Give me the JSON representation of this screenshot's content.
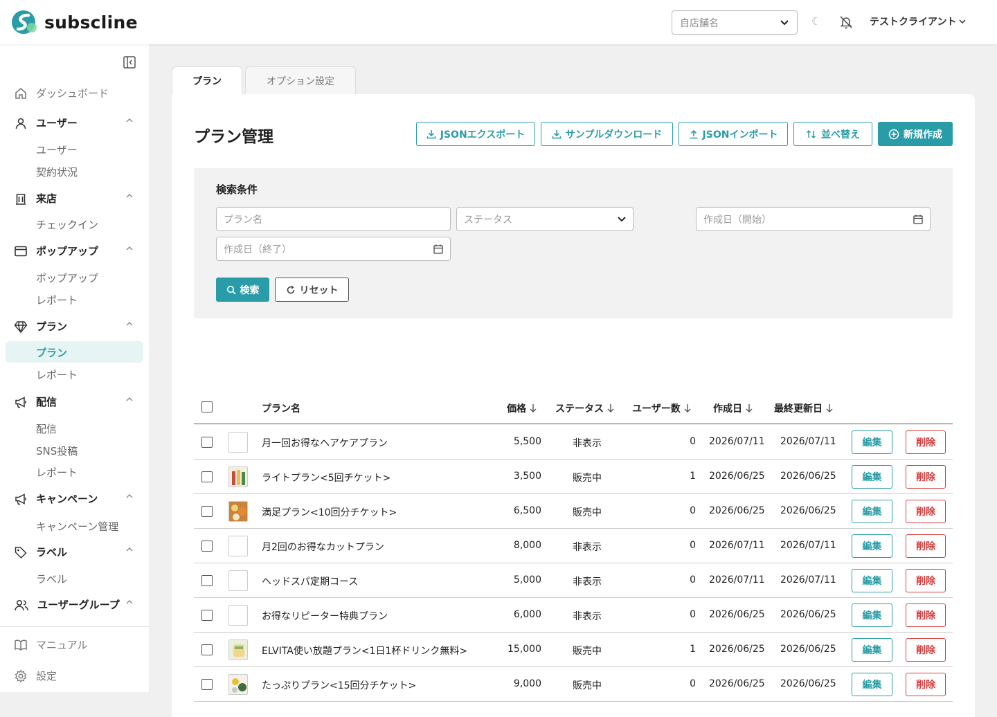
{
  "app": {
    "name": "subscline"
  },
  "header": {
    "store_placeholder": "自店舗名",
    "moon_glyph": "☾",
    "user_name": "テストクライアント"
  },
  "sidebar": {
    "items": [
      {
        "label": "ダッシュボード",
        "icon": "home-icon"
      },
      {
        "label": "ユーザー",
        "icon": "user-icon",
        "subs": [
          "ユーザー",
          "契約状況"
        ]
      },
      {
        "label": "来店",
        "icon": "building-icon",
        "subs": [
          "チェックイン"
        ]
      },
      {
        "label": "ポップアップ",
        "icon": "window-icon",
        "subs": [
          "ポップアップ",
          "レポート"
        ]
      },
      {
        "label": "プラン",
        "icon": "gem-icon",
        "subs": [
          "プラン",
          "レポート"
        ]
      },
      {
        "label": "配信",
        "icon": "megaphone-icon",
        "subs": [
          "配信",
          "SNS投稿",
          "レポート"
        ]
      },
      {
        "label": "キャンペーン",
        "icon": "megaphone-icon",
        "subs": [
          "キャンペーン管理"
        ]
      },
      {
        "label": "ラベル",
        "icon": "tag-icon",
        "subs": [
          "ラベル"
        ]
      },
      {
        "label": "ユーザーグループ",
        "icon": "users-icon"
      }
    ],
    "footer": {
      "manual": "マニュアル",
      "settings": "設定"
    }
  },
  "tabs": [
    "プラン",
    "オプション設定"
  ],
  "main": {
    "title": "プラン管理",
    "actions": {
      "json_export": "JSONエクスポート",
      "sample_download": "サンプルダウンロード",
      "json_import": "JSONインポート",
      "sort": "並べ替え",
      "create": "新規作成"
    }
  },
  "search": {
    "title": "検索条件",
    "plan_name_placeholder": "プラン名",
    "status_placeholder": "ステータス",
    "created_start_placeholder": "作成日（開始）",
    "created_end_placeholder": "作成日（終了）",
    "search_button": "検索",
    "reset_button": "リセット"
  },
  "table": {
    "columns": {
      "name": "プラン名",
      "price": "価格",
      "status": "ステータス",
      "users": "ユーザー数",
      "created": "作成日",
      "updated": "最終更新日"
    },
    "edit_label": "編集",
    "delete_label": "削除",
    "rows": [
      {
        "name": "月一回お得なヘアケアプラン",
        "price": "5,500",
        "status": "非表示",
        "users": "0",
        "created": "2026/07/11",
        "updated": "2026/07/11",
        "thumb": "none"
      },
      {
        "name": "ライトプラン<5回チケット>",
        "price": "3,500",
        "status": "販売中",
        "users": "1",
        "created": "2026/06/25",
        "updated": "2026/06/25",
        "thumb": "bottles"
      },
      {
        "name": "満足プラン<10回分チケット>",
        "price": "6,500",
        "status": "販売中",
        "users": "0",
        "created": "2026/06/25",
        "updated": "2026/06/25",
        "thumb": "flowers"
      },
      {
        "name": "月2回のお得なカットプラン",
        "price": "8,000",
        "status": "非表示",
        "users": "0",
        "created": "2026/07/11",
        "updated": "2026/07/11",
        "thumb": "none"
      },
      {
        "name": "ヘッドスパ定期コース",
        "price": "5,000",
        "status": "非表示",
        "users": "0",
        "created": "2026/07/11",
        "updated": "2026/07/11",
        "thumb": "none"
      },
      {
        "name": "お得なリピーター特典プラン",
        "price": "6,000",
        "status": "非表示",
        "users": "0",
        "created": "2026/06/25",
        "updated": "2026/06/25",
        "thumb": "none"
      },
      {
        "name": "ELVITA使い放題プラン<1日1杯ドリンク無料>",
        "price": "15,000",
        "status": "販売中",
        "users": "1",
        "created": "2026/06/25",
        "updated": "2026/06/25",
        "thumb": "drink"
      },
      {
        "name": "たっぷりプラン<15回分チケット>",
        "price": "9,000",
        "status": "販売中",
        "users": "0",
        "created": "2026/06/25",
        "updated": "2026/06/25",
        "thumb": "fruit"
      }
    ]
  },
  "colors": {
    "accent": "#2a9ca7",
    "danger": "#d43c3c",
    "active_bg": "#e6f4f4"
  }
}
